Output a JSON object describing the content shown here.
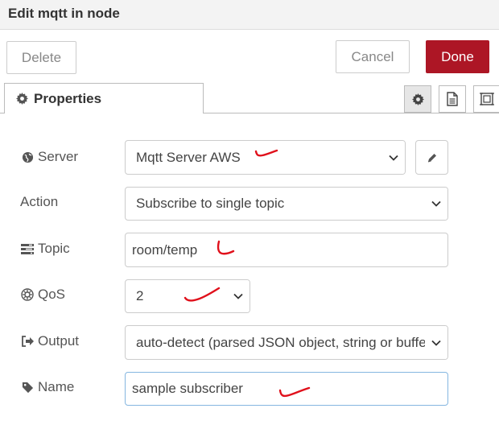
{
  "header": {
    "title": "Edit mqtt in node"
  },
  "toolbar": {
    "delete_label": "Delete",
    "cancel_label": "Cancel",
    "done_label": "Done",
    "done_color": "#ad1625"
  },
  "tabs": {
    "properties_label": "Properties"
  },
  "form": {
    "server": {
      "label": "Server",
      "value": "Mqtt Server AWS"
    },
    "action": {
      "label": "Action",
      "value": "Subscribe to single topic"
    },
    "topic": {
      "label": "Topic",
      "value": "room/temp"
    },
    "qos": {
      "label": "QoS",
      "value": "2"
    },
    "output": {
      "label": "Output",
      "value": "auto-detect (parsed JSON object, string or buffer)"
    },
    "name": {
      "label": "Name",
      "value": "sample subscriber"
    }
  },
  "annotations": {
    "check_mark_color": "#e0101b"
  }
}
